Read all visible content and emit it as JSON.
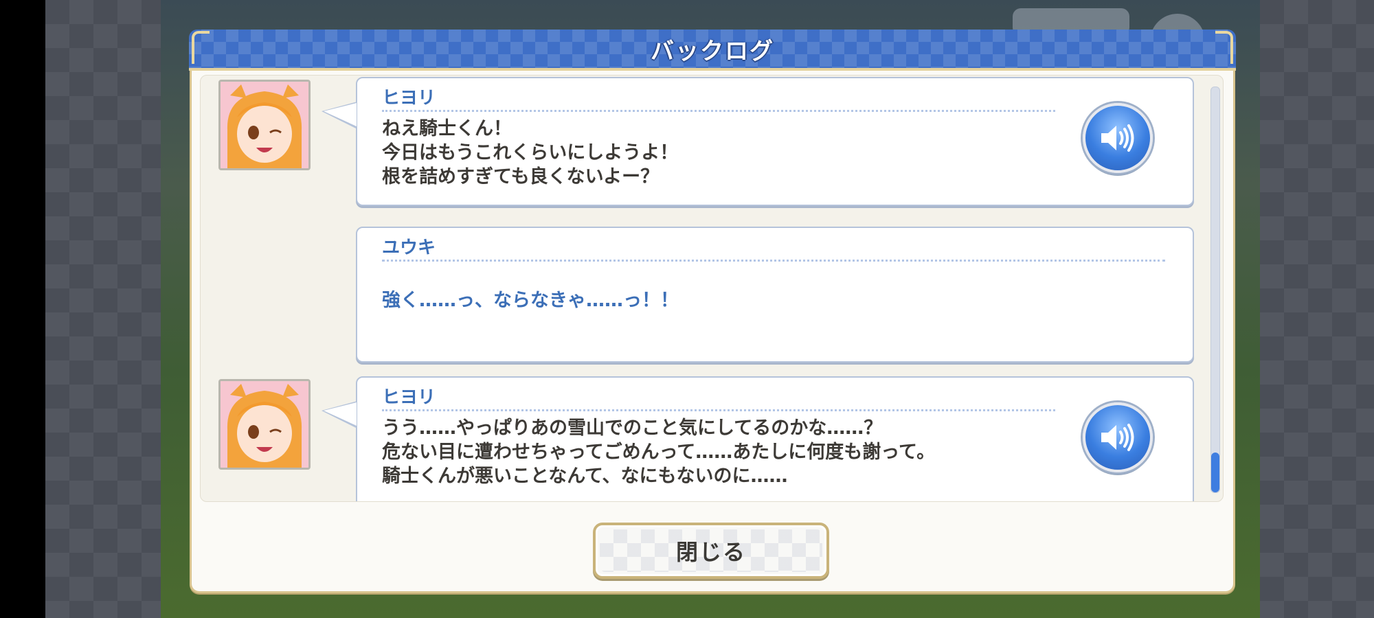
{
  "dialog": {
    "title": "バックログ",
    "close_label": "閉じる"
  },
  "entries": [
    {
      "speaker": "ヒヨリ",
      "lines": [
        "ねえ騎士くん！",
        "今日はもうこれくらいにしようよ！",
        "根を詰めすぎても良くないよー？"
      ],
      "has_portrait": true,
      "has_voice": true
    },
    {
      "speaker": "ユウキ",
      "lines": [
        "強く……っ、ならなきゃ……っ！！"
      ],
      "has_portrait": false,
      "has_voice": false
    },
    {
      "speaker": "ヒヨリ",
      "lines": [
        "うう……やっぱりあの雪山でのこと気にしてるのかな……？",
        "危ない目に遭わせちゃってごめんって……あたしに何度も謝って。",
        "騎士くんが悪いことなんて、なにもないのに……"
      ],
      "has_portrait": true,
      "has_voice": true
    }
  ],
  "icons": {
    "portrait": "character-portrait-hiyori",
    "voice": "speaker-volume-icon"
  },
  "colors": {
    "title_bar": "#3f6fc7",
    "speaker_name": "#3c6fb7",
    "player_line": "#3c6fb7",
    "npc_line": "#3d3a36",
    "frame_gold": "#d9c48e",
    "voice_button": "#3a7ee0",
    "scroll_thumb": "#3e7de0"
  },
  "scroll": {
    "position": 1.0
  }
}
